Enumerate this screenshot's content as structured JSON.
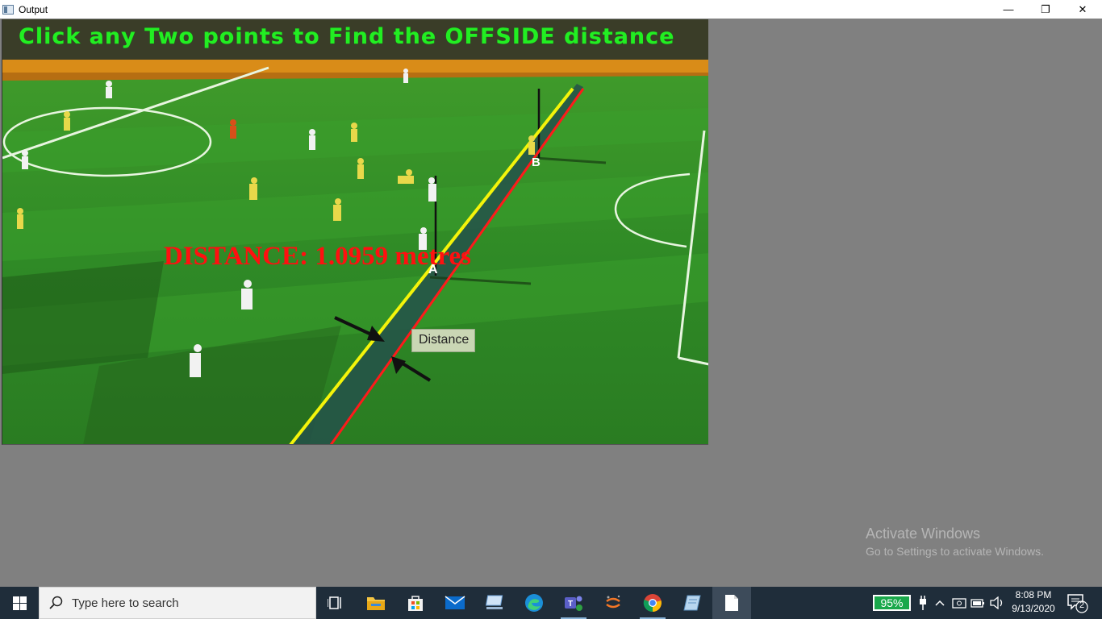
{
  "window": {
    "title": "Output",
    "minimize_glyph": "—",
    "maximize_glyph": "❐",
    "close_glyph": "✕"
  },
  "output": {
    "instruction": "Click any Two points to Find the OFFSIDE distance",
    "distance_readout": "DISTANCE: 1.0959 metres",
    "point_a_label": "A",
    "point_b_label": "B",
    "distance_tag": "Distance",
    "colors": {
      "instruction": "#22ee22",
      "distance": "#ff1010",
      "yellow_line": "#f4f40a",
      "red_line": "#ff1a1a"
    }
  },
  "watermark": {
    "title": "Activate Windows",
    "subtitle": "Go to Settings to activate Windows."
  },
  "taskbar": {
    "search_placeholder": "Type here to search",
    "apps": [
      {
        "name": "task-view",
        "icon": "task-view-icon"
      },
      {
        "name": "file-explorer",
        "icon": "folder-icon"
      },
      {
        "name": "microsoft-store",
        "icon": "store-icon"
      },
      {
        "name": "mail",
        "icon": "mail-icon"
      },
      {
        "name": "this-pc",
        "icon": "computer-icon"
      },
      {
        "name": "edge",
        "icon": "edge-icon"
      },
      {
        "name": "teams",
        "icon": "teams-icon"
      },
      {
        "name": "jupyter",
        "icon": "jupyter-icon"
      },
      {
        "name": "chrome",
        "icon": "chrome-icon"
      },
      {
        "name": "notes",
        "icon": "notes-icon"
      },
      {
        "name": "document",
        "icon": "document-icon"
      }
    ],
    "battery_percent": "95%",
    "clock_time": "8:08 PM",
    "clock_date": "9/13/2020",
    "notification_count": "2"
  }
}
